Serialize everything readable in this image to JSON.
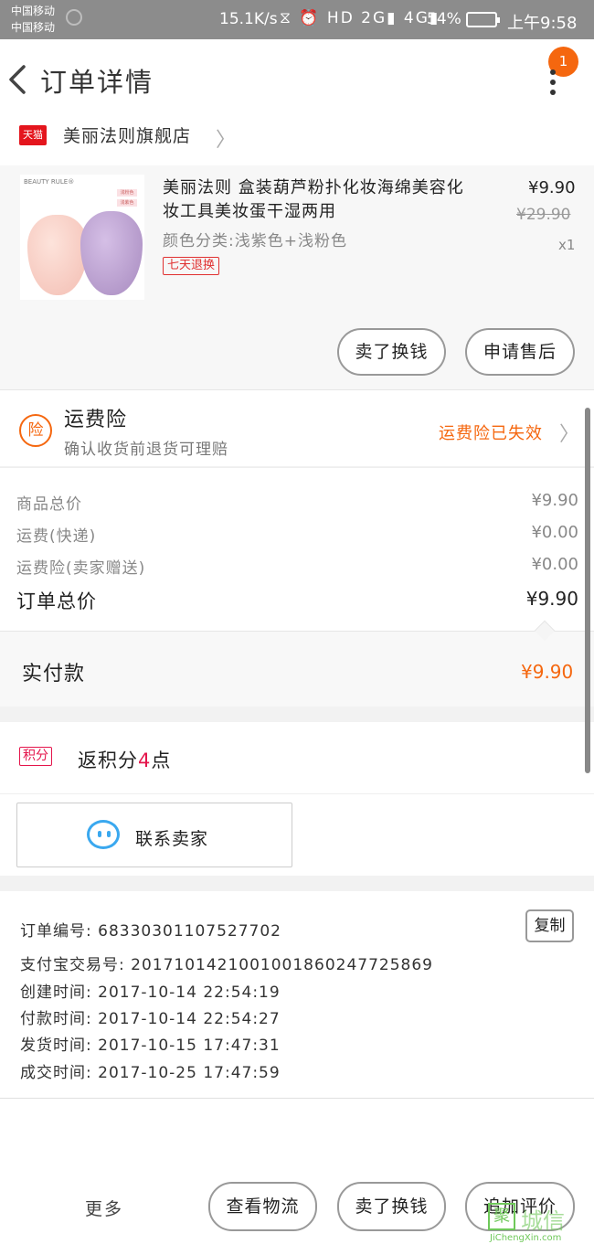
{
  "status_bar": {
    "carrier1": "中国移动",
    "carrier2": "中国移动",
    "speed": "15.1K/s",
    "icons": "⧖ ⏰ HD 2G▮ 4G▮",
    "battery": "54%",
    "time": "上午9:58"
  },
  "header": {
    "title": "订单详情",
    "badge": "1"
  },
  "shop": {
    "platform": "天猫",
    "name": "美丽法则旗舰店"
  },
  "product": {
    "image_logo": "BEAUTY RULE®",
    "image_tag1": "浅粉色",
    "image_tag2": "浅紫色",
    "title": "美丽法则 盒装葫芦粉扑化妆海绵美容化妆工具美妆蛋干湿两用",
    "sku": "颜色分类:浅紫色+浅粉色",
    "tag": "七天退换",
    "price": "¥9.90",
    "original_price": "¥29.90",
    "quantity": "x1",
    "btn_refund": "卖了换钱",
    "btn_after_sale": "申请售后"
  },
  "insurance": {
    "icon": "险",
    "title": "运费险",
    "subtitle": "确认收货前退货可理赔",
    "status": "运费险已失效"
  },
  "prices": {
    "rows": [
      {
        "label": "商品总价",
        "value": "¥9.90"
      },
      {
        "label": "运费(快递)",
        "value": "¥0.00"
      },
      {
        "label": "运费险(卖家赠送)",
        "value": "¥0.00"
      }
    ],
    "total_label": "订单总价",
    "total_value": "¥9.90"
  },
  "paid": {
    "label": "实付款",
    "value": "¥9.90"
  },
  "points": {
    "icon": "积分",
    "text_prefix": "返积分",
    "count": "4",
    "text_suffix": "点"
  },
  "contact": {
    "label": "联系卖家"
  },
  "order_info": {
    "copy": "复制",
    "rows": [
      "订单编号: 68330301107527702",
      "支付宝交易号: 2017101421001001860247725869",
      "创建时间: 2017-10-14 22:54:19",
      "付款时间: 2017-10-14 22:54:27",
      "发货时间: 2017-10-15 17:47:31",
      "成交时间: 2017-10-25 17:47:59"
    ]
  },
  "bottom_bar": {
    "more": "更多",
    "logistics": "查看物流",
    "refund": "卖了换钱",
    "review": "追加评价"
  },
  "watermark": {
    "box": "聚",
    "text": "城信",
    "url": "JiChengXin.com"
  },
  "colors": {
    "accent": "#f5670f",
    "tmall_red": "#e4151d",
    "points_red": "#e4154b",
    "chat_blue": "#3aa8ef"
  }
}
